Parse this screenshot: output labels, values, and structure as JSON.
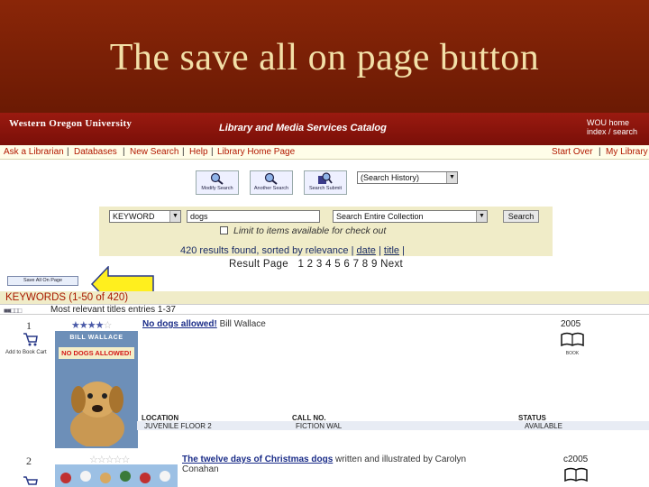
{
  "slide": {
    "title": "The save all on page button"
  },
  "banner": {
    "institution": "Western Oregon University",
    "catalog": "Library and Media Services Catalog",
    "home": "WOU home index / search"
  },
  "linkbar": {
    "items": [
      "Ask a Librarian",
      "Databases",
      "New Search",
      "Help",
      "Library Home Page"
    ],
    "right": [
      "Start Over",
      "My Library"
    ]
  },
  "toolbar": {
    "modify": "Modify Search",
    "another": "Another Search",
    "submit": "Search Submit",
    "history_value": "(Search History)"
  },
  "search": {
    "type_value": "KEYWORD",
    "query_value": "dogs",
    "scope_value": "Search Entire Collection",
    "button": "Search",
    "limit_label": "Limit to items available for check out",
    "results_text": "420 results found, sorted by relevance",
    "sort_date": "date",
    "sort_title": "title",
    "pager_label": "Result Page",
    "pager_pages": "1 2 3 4 5 6 7 8 9 Next"
  },
  "save_all_button": "Save All On Page",
  "keywords_heading": "KEYWORDS (1-50 of 420)",
  "relevance_text": "Most relevant titles entries 1-37",
  "results": [
    {
      "number": "1",
      "title": "No dogs allowed!",
      "author": "Bill Wallace",
      "year": "2005",
      "cart_label": "Add to Book Cart",
      "format": "BOOK",
      "cover_author": "BILL WALLACE",
      "cover_title": "NO DOGS ALLOWED!",
      "location_header": "LOCATION",
      "callno_header": "CALL NO.",
      "status_header": "STATUS",
      "location": "JUVENILE FLOOR 2",
      "callno": "FICTION WAL",
      "status": "AVAILABLE"
    },
    {
      "number": "2",
      "title": "The twelve days of Christmas dogs",
      "author": "written and illustrated by Carolyn",
      "author2": "Conahan",
      "year": "c2005",
      "cart_label": "Add to Book Cart",
      "format": "BOOK"
    }
  ]
}
